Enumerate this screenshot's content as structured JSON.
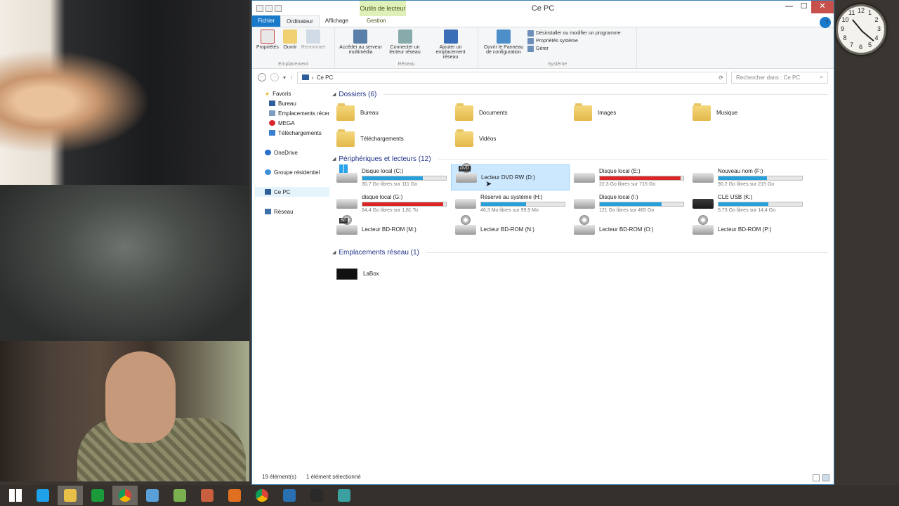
{
  "window": {
    "title": "Ce PC",
    "context_tab_group": "Outils de lecteur"
  },
  "tabs": {
    "file": "Fichier",
    "computer": "Ordinateur",
    "view": "Affichage",
    "manage": "Gestion"
  },
  "ribbon": {
    "emplacement": {
      "label": "Emplacement",
      "buttons": [
        "Propriétés",
        "Ouvrir",
        "Renommer"
      ]
    },
    "reseau": {
      "label": "Réseau",
      "buttons": [
        "Accéder au serveur multimédia",
        "Connecter un lecteur réseau",
        "Ajouter un emplacement réseau"
      ]
    },
    "systeme": {
      "label": "Système",
      "big_button": "Ouvrir le Panneau de configuration",
      "small": [
        "Désinstaller ou modifier un programme",
        "Propriétés système",
        "Gérer"
      ]
    }
  },
  "address": {
    "path": "Ce PC",
    "search_placeholder": "Rechercher dans : Ce PC"
  },
  "nav_pane": {
    "favorites": "Favoris",
    "favorite_items": [
      "Bureau",
      "Emplacements récents",
      "MEGA",
      "Téléchargements"
    ],
    "onedrive": "OneDrive",
    "homegroup": "Groupe résidentiel",
    "thispc": "Ce PC",
    "network": "Réseau"
  },
  "sections": {
    "folders": "Dossiers (6)",
    "devices": "Périphériques et lecteurs (12)",
    "network": "Emplacements réseau (1)"
  },
  "folders": [
    "Bureau",
    "Documents",
    "Images",
    "Musique",
    "Téléchargements",
    "Vidéos"
  ],
  "drives": [
    {
      "name": "Disque local (C:)",
      "free": "30,7 Go libres sur 111 Go",
      "used": 0.72,
      "color": "#26a0da",
      "icon": "win8"
    },
    {
      "name": "Lecteur DVD RW (D:)",
      "free": "",
      "used": 0,
      "color": "#26a0da",
      "icon": "dvd"
    },
    {
      "name": "Disque local (E:)",
      "free": "22,3 Go libres sur 715 Go",
      "used": 0.97,
      "color": "#da2626",
      "icon": "hdd"
    },
    {
      "name": "Nouveau nom (F:)",
      "free": "90,2 Go libres sur 215 Go",
      "used": 0.58,
      "color": "#26a0da",
      "icon": "hdd"
    },
    {
      "name": "disque local (G:)",
      "free": "64,4 Go libres sur 1,81 To",
      "used": 0.97,
      "color": "#da2626",
      "icon": "hdd"
    },
    {
      "name": "Réservé au système (H:)",
      "free": "46,3 Mo libres sur 99,9 Mo",
      "used": 0.54,
      "color": "#26a0da",
      "icon": "hdd"
    },
    {
      "name": "Disque local (I:)",
      "free": "121 Go libres sur 465 Go",
      "used": 0.74,
      "color": "#26a0da",
      "icon": "hdd"
    },
    {
      "name": "CLE USB (K:)",
      "free": "5,73 Go libres sur 14,4 Go",
      "used": 0.6,
      "color": "#26a0da",
      "icon": "usb"
    },
    {
      "name": "Lecteur BD-ROM (M:)",
      "free": "",
      "used": 0,
      "color": "#26a0da",
      "icon": "bd"
    },
    {
      "name": "Lecteur BD-ROM (N:)",
      "free": "",
      "used": 0,
      "color": "#26a0da",
      "icon": "disc"
    },
    {
      "name": "Lecteur BD-ROM (O:)",
      "free": "",
      "used": 0,
      "color": "#26a0da",
      "icon": "disc"
    },
    {
      "name": "Lecteur BD-ROM (P:)",
      "free": "",
      "used": 0,
      "color": "#26a0da",
      "icon": "disc"
    }
  ],
  "network_items": [
    "LaBox"
  ],
  "status": {
    "count": "19 élément(s)",
    "selected": "1 élément sélectionné"
  },
  "clock_numbers": [
    "12",
    "1",
    "2",
    "3",
    "4",
    "5",
    "6",
    "7",
    "8",
    "9",
    "10",
    "11"
  ],
  "taskbar_icons": [
    "start-icon",
    "internet-explorer-icon",
    "file-explorer-icon",
    "store-icon",
    "chrome-icon",
    "remote-desktop-icon",
    "app-icon",
    "app-icon-2",
    "firefox-icon",
    "chrome-icon-2",
    "app-icon-3",
    "steam-icon",
    "app-icon-4"
  ]
}
